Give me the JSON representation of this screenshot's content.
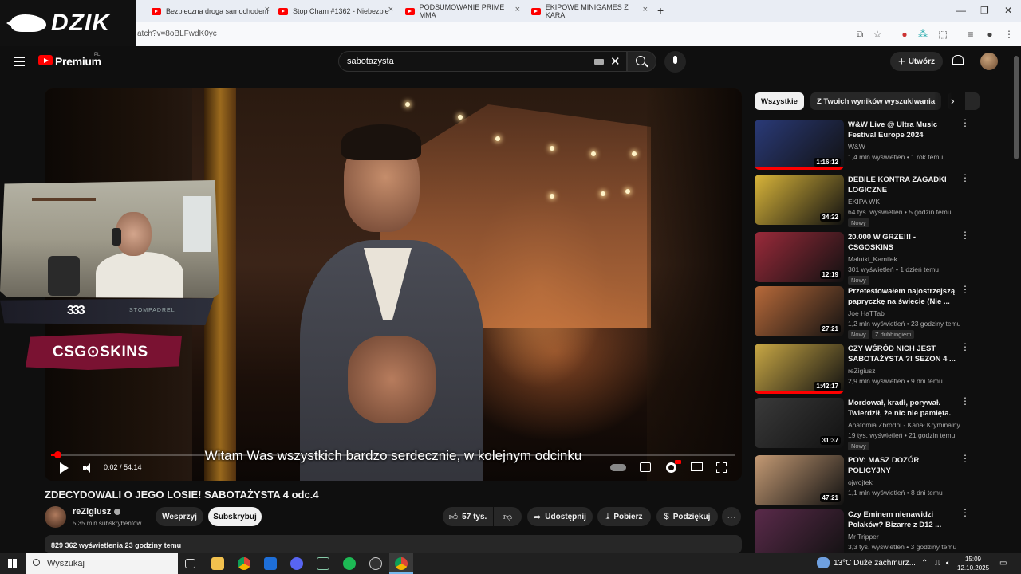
{
  "browser": {
    "tabs": [
      {
        "label": "Bezpieczna droga samochodem"
      },
      {
        "label": "Stop Cham #1362 - Niebezpie"
      },
      {
        "label": "PODSUMOWANIE PRIME MMA"
      },
      {
        "label": "EKIPOWE MINIGAMES Z KARA"
      }
    ],
    "url": "atch?v=8oBLFwdK0yc",
    "new_tab": "+",
    "close_glyph": "×"
  },
  "overlay": {
    "dzik_logo": "DZIK",
    "cam_bar_logo": "333",
    "cam_bar_sponsor": "STOMPADREL",
    "csg_logo": "CSG⊙SKINS"
  },
  "header": {
    "brand": "Premium",
    "brand_region": "PL",
    "search_value": "sabotazysta",
    "create_label": "Utwórz"
  },
  "player": {
    "subtitle": "Witam Was wszystkich bardzo serdecznie, w kolejnym odcinku",
    "time": "0:02 / 54:14",
    "progress": 0.0006
  },
  "video": {
    "title": "ZDECYDOWALI O JEGO LOSIE! SABOTAŻYSTA 4 odc.4",
    "channel": "reZigiusz",
    "subscribers": "5,35 mln subskrybentów",
    "support_label": "Wesprzyj",
    "subscribe_label": "Subskrybuj",
    "likes": "57 tys.",
    "share_label": "Udostępnij",
    "download_label": "Pobierz",
    "thanks_label": "Podziękuj",
    "more_glyph": "⋯",
    "stats": "829 362 wyświetlenia  23 godziny temu"
  },
  "sidebar": {
    "chips": [
      "Wszystkie",
      "Z Twoich wyników wyszukiwania"
    ],
    "recommendations": [
      {
        "title": "W&W Live @ Ultra Music Festival Europe 2024",
        "channel": "W&W",
        "meta": "1,4 mln wyświetleń • 1 rok temu",
        "duration": "1:16:12",
        "badges": [],
        "watched": 1.0,
        "color": "#2a3a78"
      },
      {
        "title": "DEBILE KONTRA ZAGADKI LOGICZNE",
        "channel": "EKIPA WK",
        "meta": "64 tys. wyświetleń • 5 godzin temu",
        "duration": "34:22",
        "badges": [
          "Nowy"
        ],
        "watched": 0,
        "color": "#d9b53a"
      },
      {
        "title": "20.000 W GRZE!!! - CSGOSKINS",
        "channel": "Malutki_Kamilek",
        "meta": "301 wyświetleń • 1 dzień temu",
        "duration": "12:19",
        "badges": [
          "Nowy"
        ],
        "watched": 0,
        "color": "#9a2a3a"
      },
      {
        "title": "Przetestowałem najostrzejszą papryczkę na świecie (Nie ...",
        "channel": "Joe HaTTab",
        "meta": "1,2 mln wyświetleń • 23 godziny temu",
        "duration": "27:21",
        "badges": [
          "Nowy",
          "Z dubbingiem"
        ],
        "watched": 0,
        "color": "#b86a3a"
      },
      {
        "title": "CZY WŚRÓD NICH JEST SABOTAŻYSTA ?! SEZON 4 ...",
        "channel": "reZigiusz",
        "meta": "2,9 mln wyświetleń • 9 dni temu",
        "duration": "1:42:17",
        "badges": [],
        "watched": 1.0,
        "color": "#c9a845"
      },
      {
        "title": "Mordował, kradł, porywał. Twierdził, że nic nie pamięta.",
        "channel": "Anatomia Zbrodni - Kanał Kryminalny",
        "meta": "19 tys. wyświetleń • 21 godzin temu",
        "duration": "31:37",
        "badges": [
          "Nowy"
        ],
        "watched": 0,
        "color": "#3a3a3a"
      },
      {
        "title": "POV: MASZ DOZÓR POLICYJNY",
        "channel": "ojwojtek",
        "meta": "1,1 mln wyświetleń • 8 dni temu",
        "duration": "47:21",
        "badges": [],
        "watched": 0,
        "color": "#c49a74"
      },
      {
        "title": "Czy Eminem nienawidzi Polaków? Bizarre z D12 ...",
        "channel": "Mr Tripper",
        "meta": "3,3 tys. wyświetleń • 3 godziny temu",
        "duration": "",
        "badges": [],
        "watched": 0,
        "color": "#5a2a4a"
      }
    ]
  },
  "taskbar": {
    "search_label": "Wyszukaj",
    "weather": "13°C  Duże zachmurz...",
    "time": "15:09",
    "date": "12.10.2025"
  }
}
